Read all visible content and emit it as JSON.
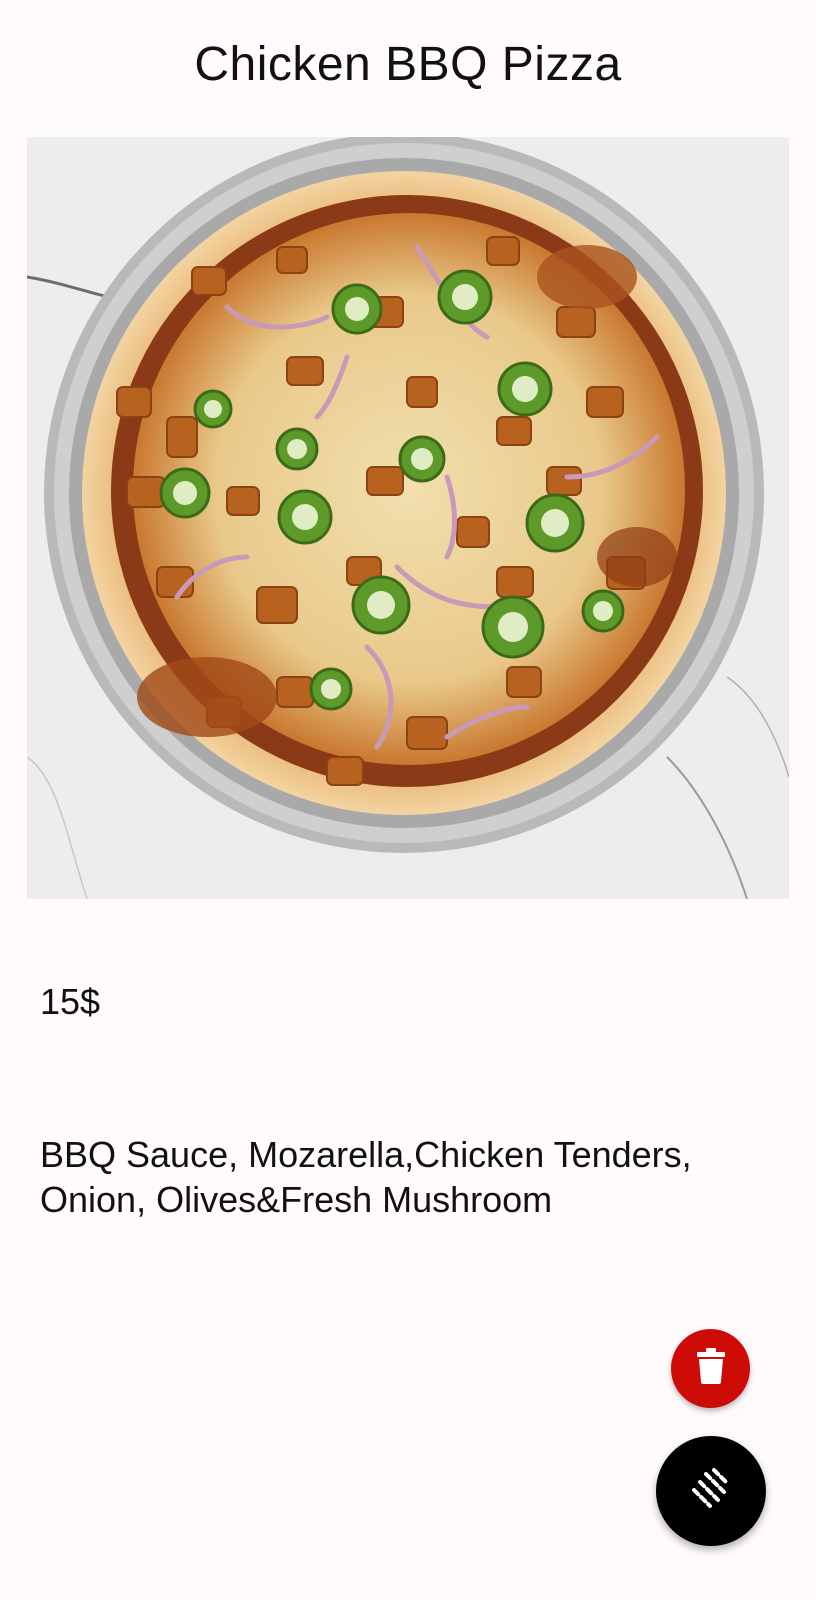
{
  "product": {
    "title": "Chicken BBQ Pizza",
    "price": "15$",
    "ingredients": "BBQ Sauce, Mozarella,Chicken Tenders, Onion, Olives&Fresh Mushroom"
  },
  "actions": {
    "delete": {
      "icon": "trash-icon",
      "color": "#cc0a06"
    },
    "main": {
      "icon": "menu-lines-icon",
      "color": "#000000"
    }
  }
}
